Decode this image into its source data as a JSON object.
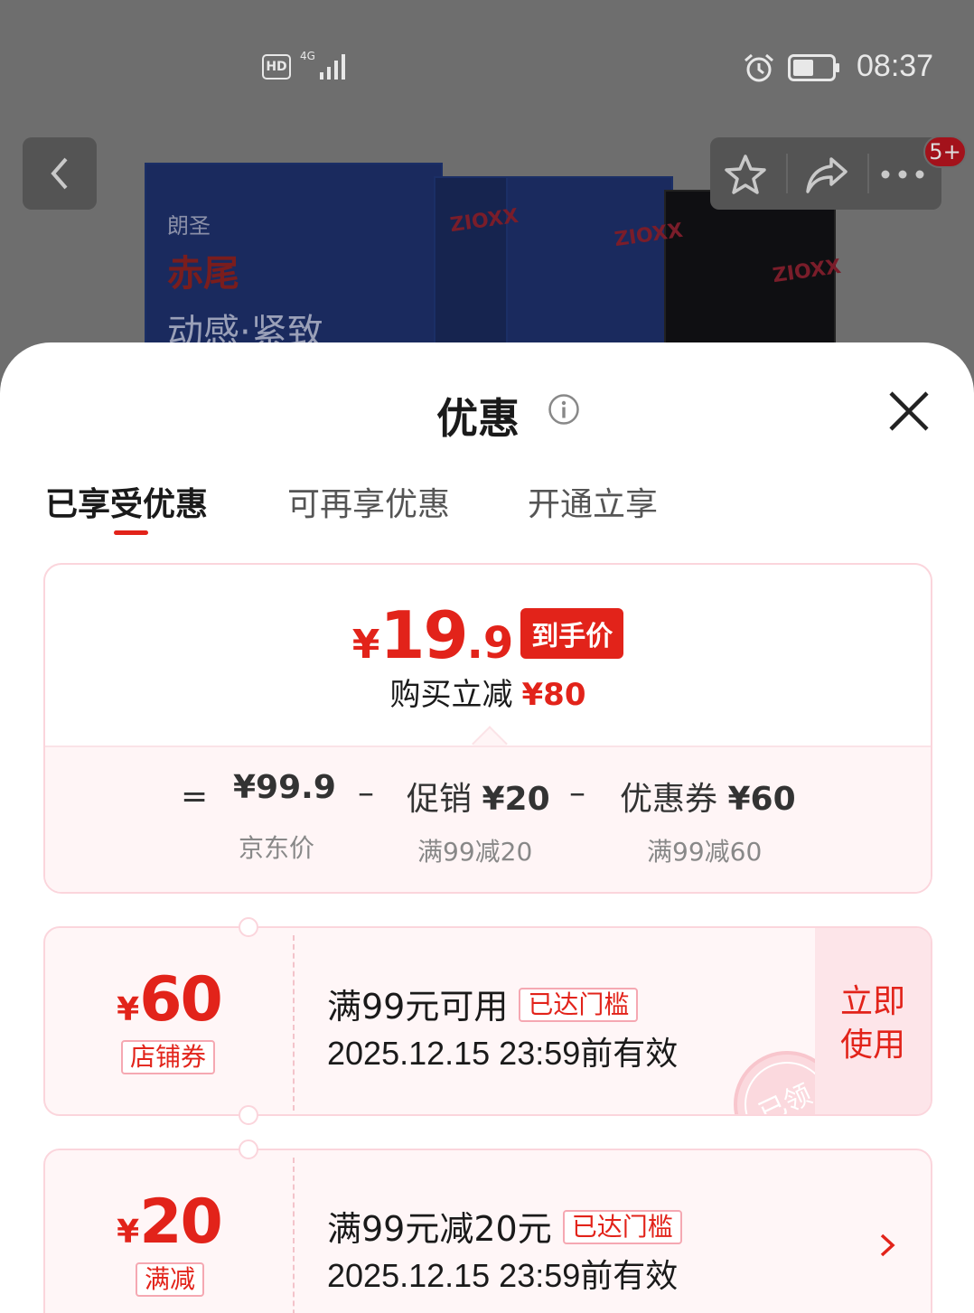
{
  "status_bar": {
    "hd": "HD",
    "network": "4G",
    "time": "08:37"
  },
  "product_image": {
    "brand": "朗圣",
    "name": "赤尾",
    "slogan": "动感·紧致",
    "logo_text": "ZIOXX"
  },
  "header": {
    "cart_badge": "5+"
  },
  "sheet": {
    "title": "优惠",
    "tabs": [
      {
        "label": "已享受优惠",
        "active": true
      },
      {
        "label": "可再享优惠",
        "active": false
      },
      {
        "label": "开通立享",
        "active": false
      }
    ]
  },
  "summary": {
    "price_symbol": "¥",
    "price_int": "19",
    "price_dec": ".9",
    "price_tag": "到手价",
    "reduce_label": "购买立减",
    "reduce_amount": "¥80",
    "eq": "=",
    "minus": "–",
    "jd_price": "¥99.9",
    "jd_label": "京东价",
    "promo_label": "促销",
    "promo_amount": "¥20",
    "promo_sub": "满99减20",
    "coupon_label": "优惠券",
    "coupon_amount": "¥60",
    "coupon_sub": "满99减60"
  },
  "coupons": [
    {
      "symbol": "¥",
      "amount": "60",
      "type": "店铺券",
      "title": "满99元可用",
      "flag": "已达门槛",
      "date": "2025.12.15 23:59前有效",
      "action": "立即使用",
      "stamp": "已领"
    },
    {
      "symbol": "¥",
      "amount": "20",
      "type": "满减",
      "title": "满99元减20元",
      "flag": "已达门槛",
      "date": "2025.12.15 23:59前有效"
    }
  ],
  "colors": {
    "accent_red": "#e2231a",
    "card_border": "#fbd5dc",
    "card_bg": "#fff6f7"
  }
}
